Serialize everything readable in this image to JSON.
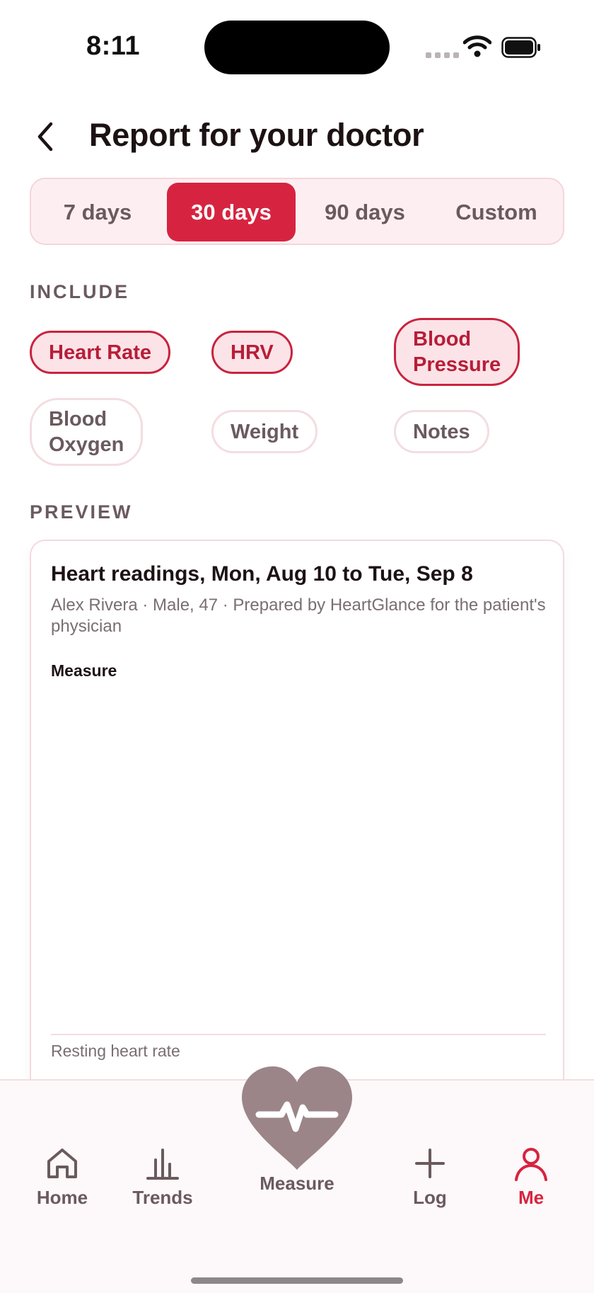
{
  "status": {
    "time": "8:11"
  },
  "header": {
    "title": "Report for your doctor"
  },
  "range": {
    "options": [
      "7 days",
      "30 days",
      "90 days",
      "Custom"
    ],
    "selected": "30 days"
  },
  "include": {
    "label": "INCLUDE",
    "chips": [
      {
        "label": "Heart Rate",
        "selected": true
      },
      {
        "label": "HRV",
        "selected": true
      },
      {
        "label": "Blood Pressure",
        "selected": true
      },
      {
        "label": "Blood Oxygen",
        "selected": false
      },
      {
        "label": "Weight",
        "selected": false
      },
      {
        "label": "Notes",
        "selected": false
      }
    ]
  },
  "preview": {
    "label": "PREVIEW",
    "title": "Heart readings, Mon, Aug 10 to Tue, Sep 8",
    "subtitle": "Alex Rivera · Male, 47 · Prepared by HeartGlance for the patient's physician",
    "measure_label": "Measure",
    "resting_label": "Resting heart rate"
  },
  "tabbar": {
    "tabs": [
      {
        "label": "Home",
        "icon": "home-icon"
      },
      {
        "label": "Trends",
        "icon": "bar-chart-icon"
      },
      {
        "label": "Measure",
        "icon": "heart-pulse-icon"
      },
      {
        "label": "Log",
        "icon": "plus-icon"
      },
      {
        "label": "Me",
        "icon": "person-icon"
      }
    ],
    "active": "Me"
  },
  "colors": {
    "accent": "#d62440",
    "chip_selected_bg": "#fbe3e8",
    "text_muted": "#6a5a5e",
    "measure_heart": "#9b8589"
  }
}
